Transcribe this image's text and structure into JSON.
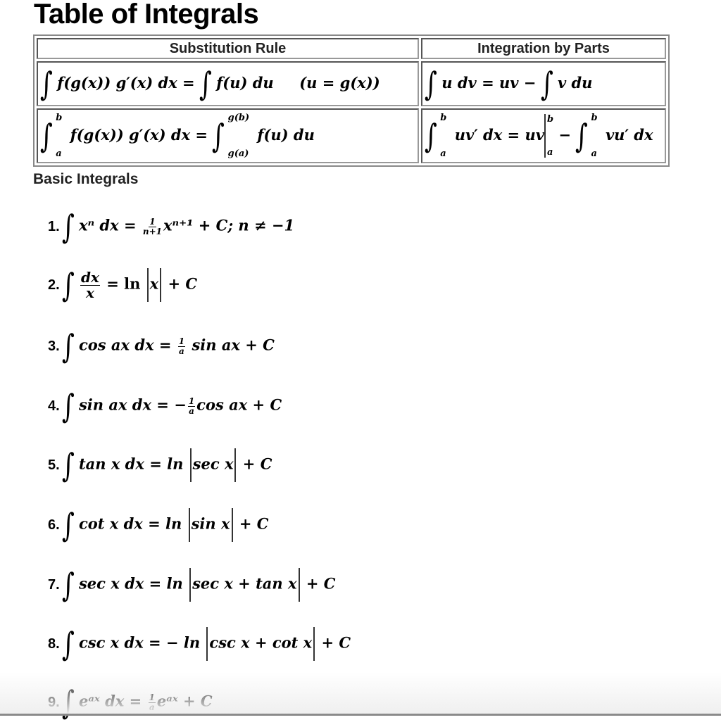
{
  "page": {
    "title": "Table of Integrals"
  },
  "rules_table": {
    "headers": [
      "Substitution Rule",
      "Integration by Parts"
    ],
    "substitution": {
      "indefinite": {
        "lhs_integrand": "f(g(x)) g′(x) dx",
        "rhs_integrand": "f(u) du",
        "note": "(u = g(x))"
      },
      "definite": {
        "lower": "a",
        "upper": "b",
        "lhs_integrand": "f(g(x)) g′(x) dx",
        "rhs_lower": "g(a)",
        "rhs_upper": "g(b)",
        "rhs_integrand": "f(u) du"
      }
    },
    "parts": {
      "indefinite": {
        "lhs_integrand": "u dv",
        "middle": "uv −",
        "rhs_integrand": "v du"
      },
      "definite": {
        "lower": "a",
        "upper": "b",
        "lhs_integrand": "uv′ dx",
        "eval_term": "uv",
        "eval_lower": "a",
        "eval_upper": "b",
        "rhs_lower": "a",
        "rhs_upper": "b",
        "rhs_integrand": "vu′ dx"
      }
    }
  },
  "basic": {
    "heading": "Basic Integrals",
    "items": [
      {
        "n": "1.",
        "integrand": "xⁿ dx",
        "frac_num": "1",
        "frac_den": "n+1",
        "rhs": "xⁿ⁺¹ + C; n ≠ −1"
      },
      {
        "n": "2.",
        "frac_num": "dx",
        "frac_den": "x",
        "rhs_pre": "= ln",
        "abs": "x",
        "rhs_post": "+ C"
      },
      {
        "n": "3.",
        "integrand": "cos ax dx =",
        "frac_num": "1",
        "frac_den": "a",
        "rhs": "sin ax + C"
      },
      {
        "n": "4.",
        "integrand": "sin ax dx = −",
        "frac_num": "1",
        "frac_den": "a",
        "rhs": "cos ax + C"
      },
      {
        "n": "5.",
        "integrand": "tan x dx = ln",
        "abs": "sec x",
        "rhs_post": "+ C"
      },
      {
        "n": "6.",
        "integrand": "cot x dx = ln",
        "abs": "sin x",
        "rhs_post": "+ C"
      },
      {
        "n": "7.",
        "integrand": "sec x dx = ln",
        "abs": "sec x + tan x",
        "rhs_post": "+ C"
      },
      {
        "n": "8.",
        "integrand": "csc x dx = − ln",
        "abs": "csc x + cot x",
        "rhs_post": "+ C"
      },
      {
        "n": "9.",
        "integrand": "eᵃˣ dx =",
        "frac_num": "1",
        "frac_den": "a",
        "rhs": "eᵃˣ + C"
      }
    ]
  },
  "symbols": {
    "integral": "∫",
    "equals": "="
  }
}
